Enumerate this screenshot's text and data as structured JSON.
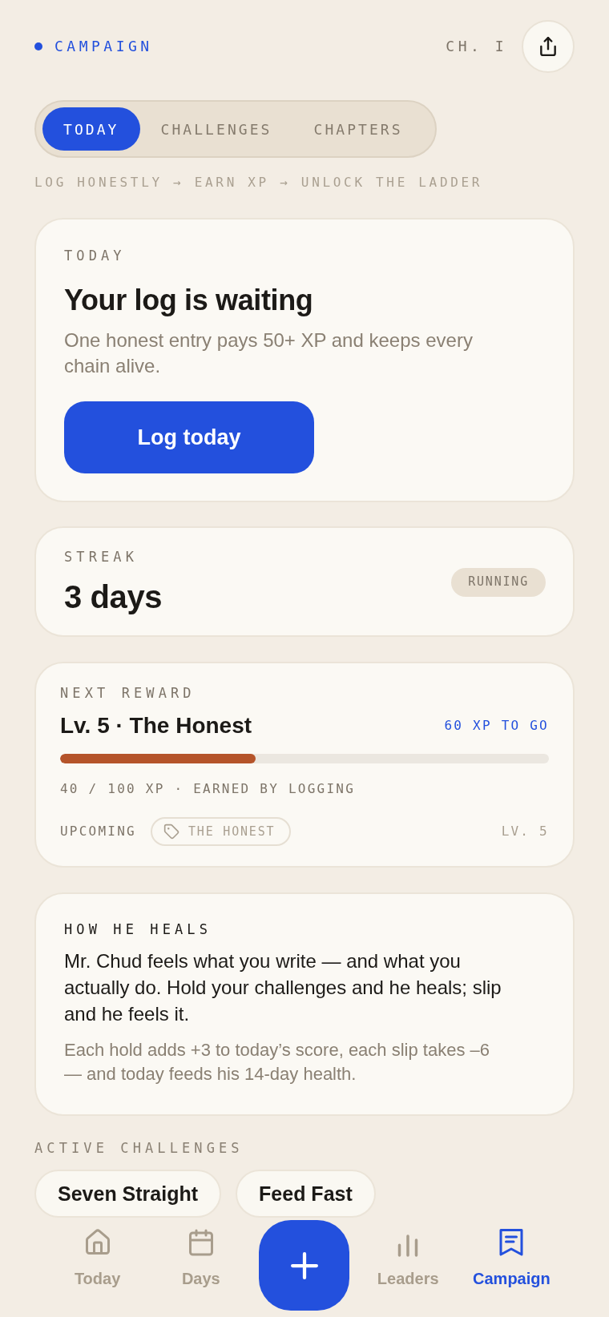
{
  "header": {
    "title": "CAMPAIGN",
    "chapter": "CH. I"
  },
  "tabs": [
    {
      "label": "TODAY",
      "selected": true
    },
    {
      "label": "CHALLENGES",
      "selected": false
    },
    {
      "label": "CHAPTERS",
      "selected": false
    }
  ],
  "tagline": "LOG HONESTLY → EARN XP → UNLOCK THE LADDER",
  "today_card": {
    "label": "TODAY",
    "title": "Your log is waiting",
    "description": "One honest entry pays 50+ XP and keeps every chain alive.",
    "button": "Log today"
  },
  "streak_card": {
    "label": "STREAK",
    "value": "3 days",
    "status": "RUNNING"
  },
  "reward_card": {
    "label": "NEXT REWARD",
    "title": "Lv. 5 · The Honest",
    "remaining": "60 XP TO GO",
    "level": 0.4,
    "progress_text": "40 / 100 XP · EARNED BY LOGGING",
    "upcoming_label": "UPCOMING",
    "tag": "THE HONEST",
    "tag_level": "LV. 5"
  },
  "heal_card": {
    "label": "HOW HE HEALS",
    "body": "Mr. Chud feels what you write — and what you actually do. Hold your challenges and he heals; slip and he feels it.",
    "note": "Each hold adds +3 to today’s score, each slip takes –6 — and today feeds his 14-day health."
  },
  "challenges": {
    "label": "ACTIVE CHALLENGES",
    "items": [
      "Seven Straight",
      "Feed Fast"
    ]
  },
  "bottom_nav": [
    {
      "label": "Today",
      "kind": "home",
      "selected": false
    },
    {
      "label": "Days",
      "kind": "calendar",
      "selected": false
    },
    {
      "label": "Leaders",
      "kind": "chart",
      "selected": false
    },
    {
      "label": "Campaign",
      "kind": "flag",
      "selected": true
    }
  ]
}
